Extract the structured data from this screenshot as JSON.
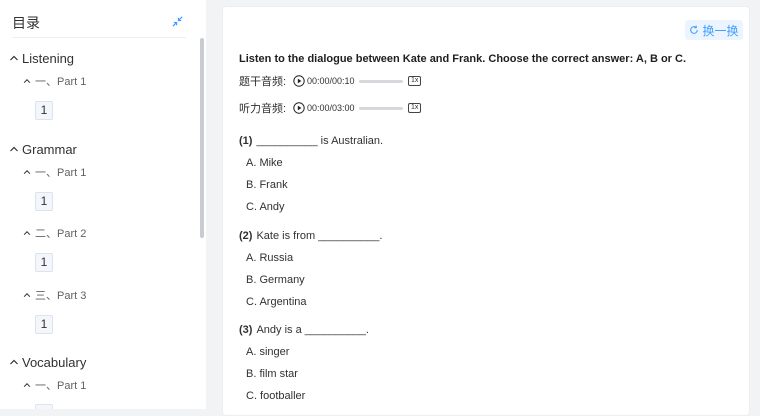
{
  "sidebar": {
    "title": "目录",
    "sections": [
      {
        "label": "Listening",
        "parts": [
          {
            "label": "一、Part 1",
            "questions": [
              "1"
            ]
          }
        ]
      },
      {
        "label": "Grammar",
        "parts": [
          {
            "label": "一、Part 1",
            "questions": [
              "1"
            ]
          },
          {
            "label": "二、Part 2",
            "questions": [
              "1"
            ]
          },
          {
            "label": "三、Part 3",
            "questions": [
              "1"
            ]
          }
        ]
      },
      {
        "label": "Vocabulary",
        "parts": [
          {
            "label": "一、Part 1",
            "questions": []
          }
        ]
      }
    ]
  },
  "main": {
    "swap_label": "换一换",
    "instruction": "Listen to the dialogue between Kate and Frank. Choose the correct answer: A, B or C.",
    "audio": [
      {
        "label": "题干音频:",
        "time": "00:00/00:10",
        "speed": "1x"
      },
      {
        "label": "听力音频:",
        "time": "00:00/03:00",
        "speed": "1x"
      }
    ],
    "questions": [
      {
        "num": "(1)",
        "text": "__________ is Australian.",
        "options": [
          "A.  Mike",
          "B.  Frank",
          "C.  Andy"
        ]
      },
      {
        "num": "(2)",
        "text": "Kate is from __________.",
        "options": [
          "A.  Russia",
          "B.  Germany",
          "C.  Argentina"
        ]
      },
      {
        "num": "(3)",
        "text": "Andy is a __________.",
        "options": [
          "A.  singer",
          "B.  film star",
          "C.  footballer"
        ]
      }
    ]
  },
  "colors": {
    "accent": "#409eff",
    "accent_bg": "#ecf5ff",
    "panel_bg": "#f2f3f5"
  }
}
